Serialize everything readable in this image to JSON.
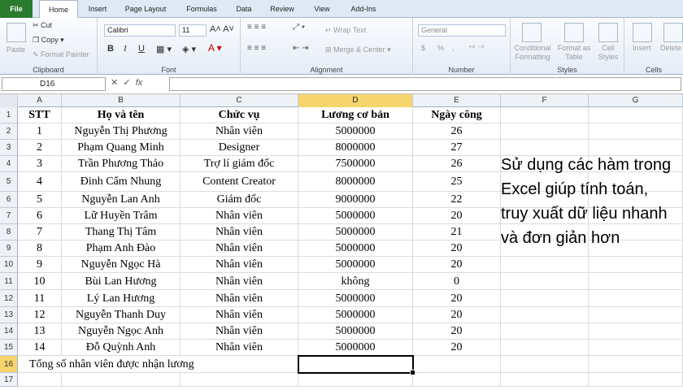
{
  "ribbon_tabs": [
    "File",
    "Home",
    "Insert",
    "Page Layout",
    "Formulas",
    "Data",
    "Review",
    "View",
    "Add-Ins"
  ],
  "clipboard": {
    "paste": "Paste",
    "cut": "Cut",
    "copy": "Copy",
    "format_painter": "Format Painter",
    "label": "Clipboard"
  },
  "font": {
    "name": "Calibri",
    "size": "11",
    "bold": "B",
    "italic": "I",
    "underline": "U",
    "label": "Font"
  },
  "alignment": {
    "wrap": "Wrap Text",
    "merge": "Merge & Center",
    "label": "Alignment"
  },
  "number": {
    "format": "General",
    "currency": "$",
    "percent": "%",
    "comma": ",",
    "label": "Number"
  },
  "styles": {
    "conditional": "Conditional Formatting",
    "format_table": "Format as Table",
    "cell_styles": "Cell Styles",
    "label": "Styles"
  },
  "cells": {
    "insert": "Insert",
    "delete": "Delete",
    "label": "Cells"
  },
  "formula_bar": {
    "name_box": "D16",
    "fx": "fx",
    "content": ""
  },
  "columns": [
    "A",
    "B",
    "C",
    "D",
    "E",
    "F",
    "G"
  ],
  "selected_column": "D",
  "selected_row": "16",
  "table": {
    "headers": [
      "STT",
      "Họ và tên",
      "Chức vụ",
      "Lương cơ bản",
      "Ngày công"
    ],
    "rows": [
      [
        "1",
        "Nguyễn Thị Phương",
        "Nhân viên",
        "5000000",
        "26"
      ],
      [
        "2",
        "Phạm Quang Minh",
        "Designer",
        "8000000",
        "27"
      ],
      [
        "3",
        "Trần Phương Thảo",
        "Trợ lí giám đốc",
        "7500000",
        "26"
      ],
      [
        "4",
        "Đinh Cẩm Nhung",
        "Content Creator",
        "8000000",
        "25"
      ],
      [
        "5",
        "Nguyễn Lan Anh",
        "Giám đốc",
        "9000000",
        "22"
      ],
      [
        "6",
        "Lữ Huyền Trâm",
        "Nhân viên",
        "5000000",
        "20"
      ],
      [
        "7",
        "Thang Thị Tâm",
        "Nhân viên",
        "5000000",
        "21"
      ],
      [
        "8",
        "Phạm Anh Đào",
        "Nhân viên",
        "5000000",
        "20"
      ],
      [
        "9",
        "Nguyễn Ngọc Hà",
        "Nhân viên",
        "5000000",
        "20"
      ],
      [
        "10",
        "Bùi Lan Hương",
        "Nhân viên",
        "không",
        "0"
      ],
      [
        "11",
        "Lý Lan Hương",
        "Nhân viên",
        "5000000",
        "20"
      ],
      [
        "12",
        "Nguyễn Thanh Duy",
        "Nhân viên",
        "5000000",
        "20"
      ],
      [
        "13",
        "Nguyễn Ngọc Anh",
        "Nhân viên",
        "5000000",
        "20"
      ],
      [
        "14",
        "Đỗ Quỳnh Anh",
        "Nhân viên",
        "5000000",
        "20"
      ]
    ],
    "summary_label": "Tổng số nhân viên được nhận lương"
  },
  "row_numbers": [
    "1",
    "2",
    "3",
    "4",
    "5",
    "6",
    "7",
    "8",
    "9",
    "10",
    "11",
    "12",
    "13",
    "14",
    "15",
    "16",
    "17"
  ],
  "note": "Sử dụng các hàm trong Excel giúp tính toán, truy xuất dữ liệu nhanh và đơn giản hơn"
}
